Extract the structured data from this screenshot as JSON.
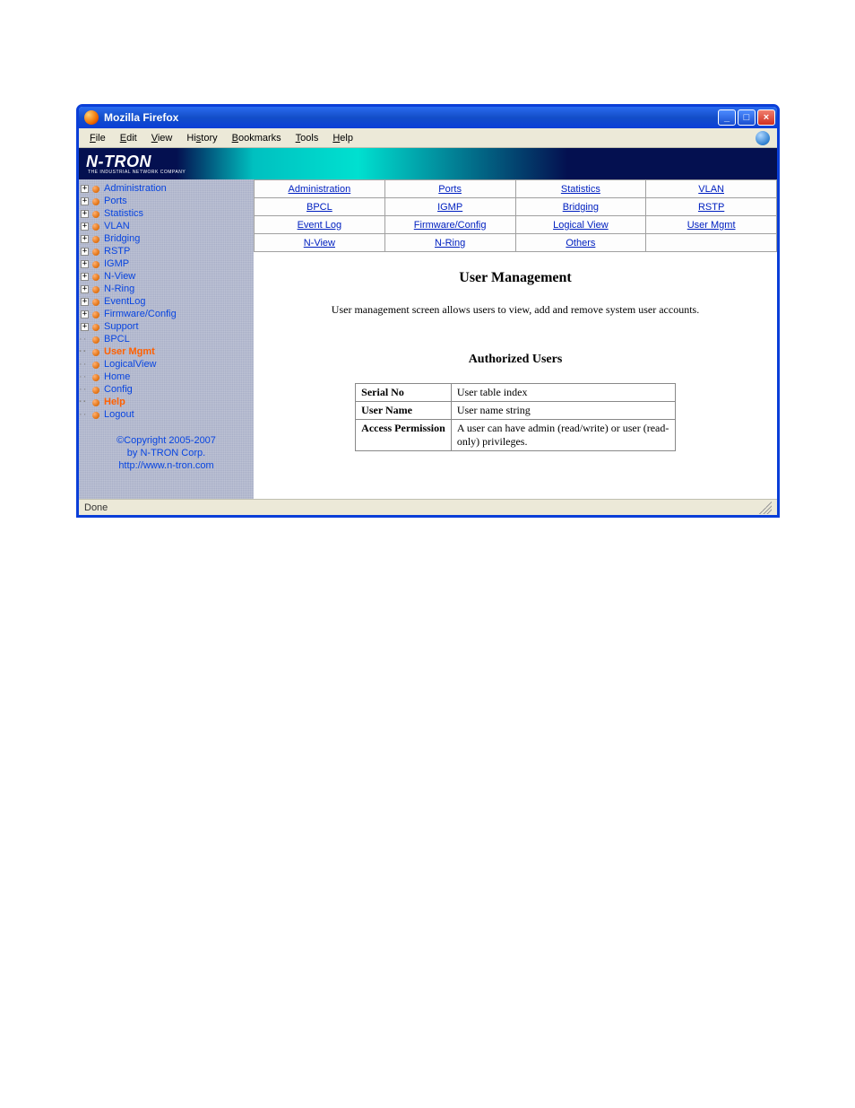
{
  "window": {
    "title": "Mozilla Firefox"
  },
  "menubar": {
    "items": [
      "File",
      "Edit",
      "View",
      "History",
      "Bookmarks",
      "Tools",
      "Help"
    ]
  },
  "logo": {
    "text": "N-TRON",
    "sub": "THE INDUSTRIAL NETWORK COMPANY"
  },
  "sidebar": {
    "items": [
      {
        "label": "Administration",
        "expandable": true,
        "highlight": false
      },
      {
        "label": "Ports",
        "expandable": true,
        "highlight": false
      },
      {
        "label": "Statistics",
        "expandable": true,
        "highlight": false
      },
      {
        "label": "VLAN",
        "expandable": true,
        "highlight": false
      },
      {
        "label": "Bridging",
        "expandable": true,
        "highlight": false
      },
      {
        "label": "RSTP",
        "expandable": true,
        "highlight": false
      },
      {
        "label": "IGMP",
        "expandable": true,
        "highlight": false
      },
      {
        "label": "N-View",
        "expandable": true,
        "highlight": false
      },
      {
        "label": "N-Ring",
        "expandable": true,
        "highlight": false
      },
      {
        "label": "EventLog",
        "expandable": true,
        "highlight": false
      },
      {
        "label": "Firmware/Config",
        "expandable": true,
        "highlight": false
      },
      {
        "label": "Support",
        "expandable": true,
        "highlight": false
      },
      {
        "label": "BPCL",
        "expandable": false,
        "highlight": false
      },
      {
        "label": "User Mgmt",
        "expandable": false,
        "highlight": true
      },
      {
        "label": "LogicalView",
        "expandable": false,
        "highlight": false
      },
      {
        "label": "Home",
        "expandable": false,
        "highlight": false
      },
      {
        "label": "Config",
        "expandable": false,
        "highlight": false
      },
      {
        "label": "Help",
        "expandable": false,
        "highlight": true
      },
      {
        "label": "Logout",
        "expandable": false,
        "highlight": false
      }
    ],
    "copyright": {
      "line1": "©Copyright 2005-2007",
      "line2": "by N-TRON Corp.",
      "line3": "http://www.n-tron.com"
    }
  },
  "tabs": {
    "rows": [
      [
        "Administration",
        "Ports",
        "Statistics",
        "VLAN"
      ],
      [
        "BPCL",
        "IGMP",
        "Bridging",
        "RSTP"
      ],
      [
        "Event Log",
        "Firmware/Config",
        "Logical View",
        "User Mgmt"
      ],
      [
        "N-View",
        "N-Ring",
        "Others",
        ""
      ]
    ]
  },
  "page": {
    "title": "User Management",
    "description": "User management screen allows users to view, add and remove system user accounts.",
    "subtitle": "Authorized Users",
    "table": [
      {
        "key": "Serial No",
        "val": "User table index"
      },
      {
        "key": "User Name",
        "val": "User name string"
      },
      {
        "key": "Access Permission",
        "val": "A user can have admin (read/write) or user (read-only) privileges."
      }
    ]
  },
  "status": {
    "text": "Done"
  }
}
